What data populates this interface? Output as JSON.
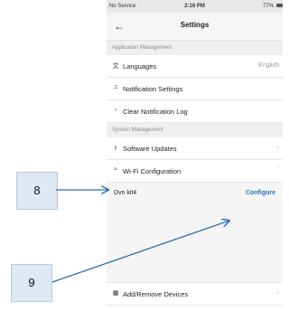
{
  "status_bar": {
    "carrier": "No Service",
    "time": "2:16 PM",
    "battery": "77%"
  },
  "header": {
    "back_icon": "arrow-left",
    "title": "Settings"
  },
  "sections": {
    "app_management": "Application Management",
    "system_management": "System Management"
  },
  "rows": {
    "languages": {
      "label": "Languages",
      "value": "English",
      "icon": "translate-icon"
    },
    "notification_settings": {
      "label": "Notification Settings",
      "icon": "bell-icon"
    },
    "clear_notification_log": {
      "label": "Clear Notification Log",
      "icon": "trash-icon"
    },
    "software_updates": {
      "label": "Software Updates",
      "icon": "download-icon"
    },
    "wifi_configuration": {
      "label": "Wi-Fi Configuration",
      "icon": "wifi-icon"
    },
    "add_remove_devices": {
      "label": "Add/Remove Devices",
      "icon": "devices-icon"
    }
  },
  "wifi_panel": {
    "device_name": "Dvn kit4",
    "configure_label": "Configure"
  },
  "annotations": {
    "step_8": "8",
    "step_9": "9",
    "arrow_color": "#2f6db5"
  }
}
